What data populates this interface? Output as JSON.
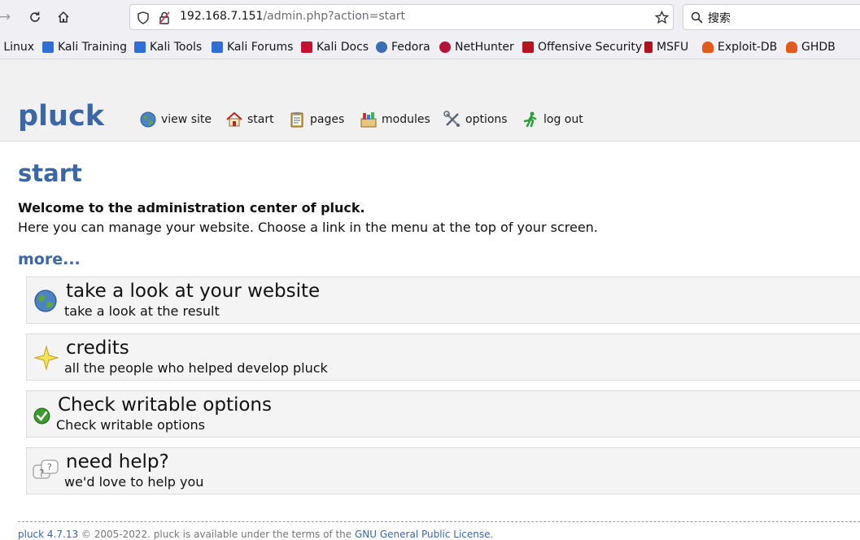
{
  "browser": {
    "url_host": "192.168.7.151",
    "url_path": "/admin.php?action=start",
    "search_placeholder": "搜索"
  },
  "bookmarks": [
    {
      "label": "i Linux",
      "icon": "kali-icon"
    },
    {
      "label": "Kali Training",
      "icon": "kali-icon"
    },
    {
      "label": "Kali Tools",
      "icon": "kali-icon"
    },
    {
      "label": "Kali Forums",
      "icon": "kali-icon"
    },
    {
      "label": "Kali Docs",
      "icon": "kali-docs-icon"
    },
    {
      "label": "Fedora",
      "icon": "fedora-icon"
    },
    {
      "label": "NetHunter",
      "icon": "nethunter-icon"
    },
    {
      "label": "Offensive Security",
      "icon": "offsec-icon"
    },
    {
      "label": "MSFU",
      "icon": "msfu-icon"
    },
    {
      "label": "Exploit-DB",
      "icon": "exploitdb-icon"
    },
    {
      "label": "GHDB",
      "icon": "ghdb-icon"
    }
  ],
  "header": {
    "logo": "pluck",
    "menu": [
      {
        "label": "view site",
        "icon": "globe-icon"
      },
      {
        "label": "start",
        "icon": "home-icon"
      },
      {
        "label": "pages",
        "icon": "clipboard-icon"
      },
      {
        "label": "modules",
        "icon": "modules-icon"
      },
      {
        "label": "options",
        "icon": "tools-icon"
      },
      {
        "label": "log out",
        "icon": "running-man-icon"
      }
    ]
  },
  "main": {
    "heading": "start",
    "welcome": "Welcome to the administration center of pluck.",
    "welcome_sub": "Here you can manage your website. Choose a link in the menu at the top of your screen.",
    "more_link": "more...",
    "cards": [
      {
        "title": "take a look at your website",
        "desc": "take a look at the result",
        "icon": "globe-icon"
      },
      {
        "title": "credits",
        "desc": "all the people who helped develop pluck",
        "icon": "star-icon"
      },
      {
        "title": "Check writable options",
        "desc": "Check writable options",
        "icon": "check-icon"
      },
      {
        "title": "need help?",
        "desc": "we'd love to help you",
        "icon": "help-icon"
      }
    ]
  },
  "footer": {
    "version_link": "pluck 4.7.13",
    "text": " © 2005-2022. pluck is available under the terms of the ",
    "license_link": "GNU General Public License",
    "end": "."
  },
  "colors": {
    "accent": "#3b67a6",
    "header_bg": "#f1f1f1",
    "card_bg": "#f4f4f4"
  }
}
